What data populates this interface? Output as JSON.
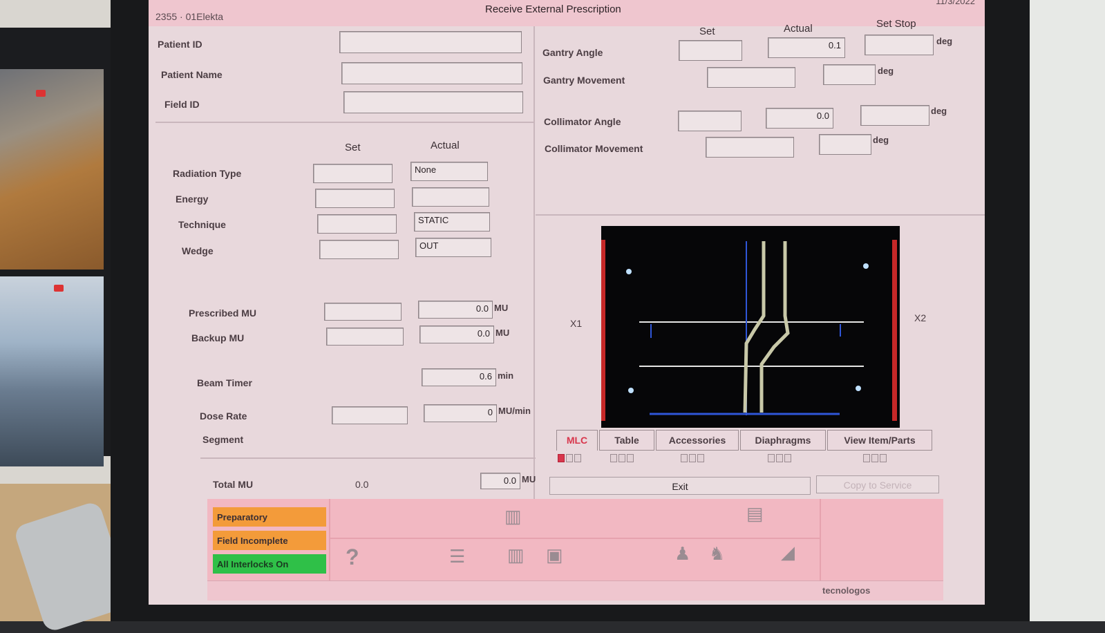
{
  "window": {
    "session_id": "2355 · 01Elekta",
    "title": "Receive External Prescription",
    "date_partial": "11/3/2022"
  },
  "patient": {
    "patient_id_label": "Patient ID",
    "patient_name_label": "Patient Name",
    "field_id_label": "Field ID",
    "patient_id_value": "",
    "patient_name_value": "",
    "field_id_value": ""
  },
  "beam": {
    "set_header": "Set",
    "actual_header": "Actual",
    "rows": [
      {
        "label": "Radiation Type",
        "set": "",
        "actual": "None"
      },
      {
        "label": "Energy",
        "set": "",
        "actual": ""
      },
      {
        "label": "Technique",
        "set": "",
        "actual": "STATIC"
      },
      {
        "label": "Wedge",
        "set": "",
        "actual": "OUT"
      }
    ],
    "prescribed_mu_label": "Prescribed MU",
    "prescribed_mu_actual": "0.0",
    "backup_mu_label": "Backup MU",
    "backup_mu_actual": "0.0",
    "mu_unit": "MU",
    "beam_timer_label": "Beam Timer",
    "beam_timer_actual": "0.6",
    "min_unit": "min",
    "dose_rate_label": "Dose Rate",
    "dose_rate_actual": "0",
    "mu_min_unit": "MU/min",
    "segment_label": "Segment",
    "total_mu_label": "Total MU",
    "total_mu_set": "0.0",
    "total_mu_actual": "0.0"
  },
  "geometry": {
    "set_header": "Set",
    "actual_header": "Actual",
    "set_stop_header": "Set Stop",
    "deg_unit": "deg",
    "gantry_angle_label": "Gantry Angle",
    "gantry_angle_actual": "0.1",
    "gantry_movement_label": "Gantry Movement",
    "collimator_angle_label": "Collimator Angle",
    "collimator_angle_actual": "0.0",
    "collimator_movement_label": "Collimator Movement"
  },
  "viewer": {
    "x1_label": "X1",
    "x2_label": "X2"
  },
  "tabs": [
    {
      "label": "MLC",
      "active": true
    },
    {
      "label": "Table",
      "active": false
    },
    {
      "label": "Accessories",
      "active": false
    },
    {
      "label": "Diaphragms",
      "active": false
    },
    {
      "label": "View Item/Parts",
      "active": false
    }
  ],
  "buttons": {
    "exit": "Exit",
    "copy": "Copy to Service"
  },
  "status": {
    "preparatory": "Preparatory",
    "field_incomplete": "Field Incomplete",
    "interlocks": "All Interlocks On",
    "colors": {
      "orange": "#f39b3a",
      "green": "#2fc048",
      "mlc_active": "#d8364c"
    }
  },
  "icons": [
    "trash-icon",
    "document-icon",
    "help-icon",
    "list-icon",
    "trash-icon",
    "clipboard-icon",
    "person-icon",
    "person-move-icon",
    "ramp-icon"
  ],
  "footer": {
    "user": "tecnologos"
  }
}
